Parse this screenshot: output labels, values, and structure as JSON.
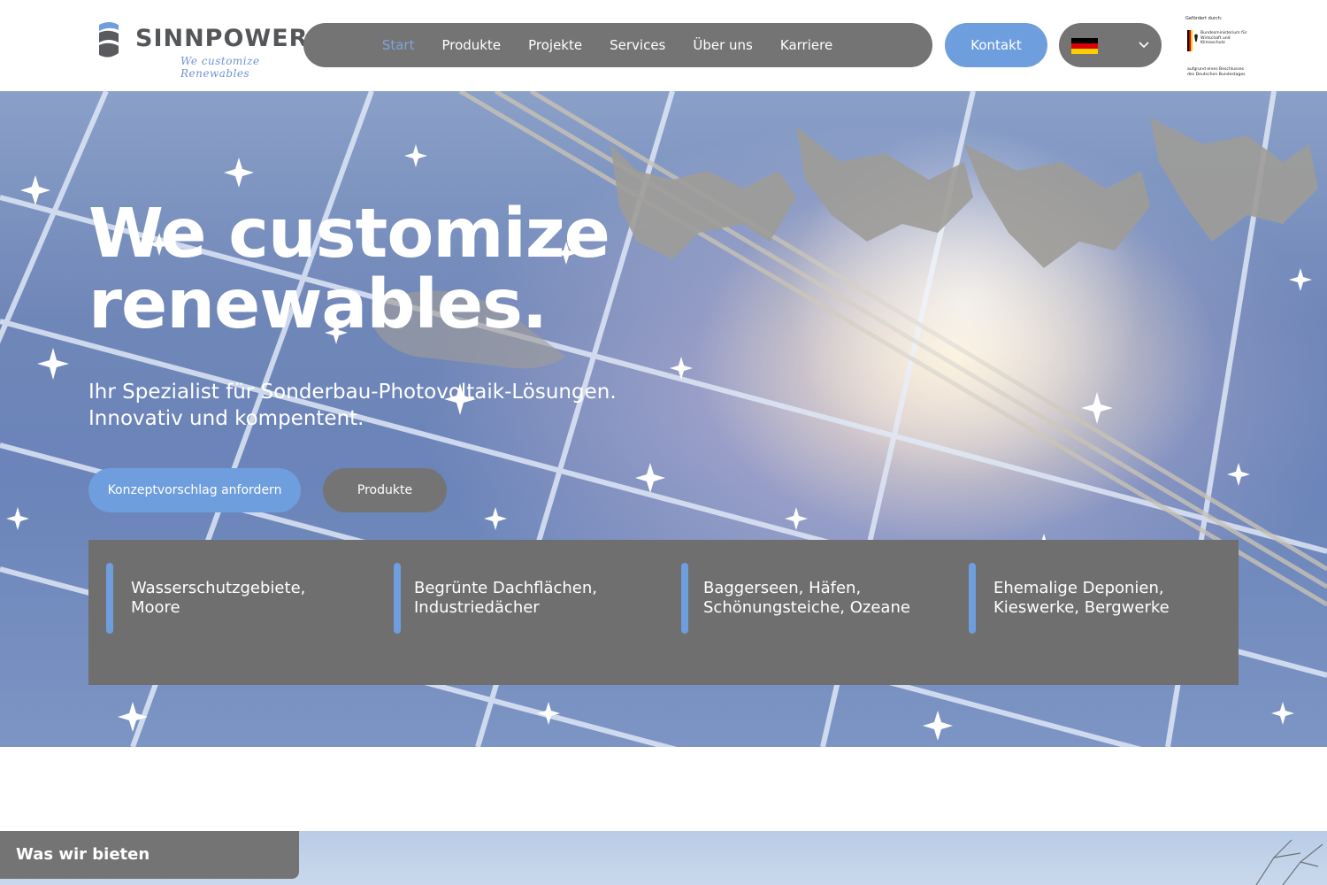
{
  "header": {
    "logo": {
      "wordmark": "SINNPOWER",
      "tagline": "We customize Renewables"
    },
    "nav": [
      {
        "label": "Start",
        "active": true
      },
      {
        "label": "Produkte",
        "active": false
      },
      {
        "label": "Projekte",
        "active": false
      },
      {
        "label": "Services",
        "active": false
      },
      {
        "label": "Über uns",
        "active": false
      },
      {
        "label": "Karriere",
        "active": false
      }
    ],
    "contact_label": "Kontakt",
    "language": {
      "flag": "de-flag-icon"
    },
    "funding": {
      "top": "Gefördert durch:",
      "ministry": "Bundesministerium für Wirtschaft und Klimaschutz",
      "bottom": "aufgrund eines Beschlusses des Deutschen Bundestages"
    }
  },
  "hero": {
    "title_line1": "We customize",
    "title_line2": "renewables.",
    "subtitle_line1": "Ihr Spezialist für Sonderbau-Photovoltaik-Lösungen.",
    "subtitle_line2": "Innovativ und kompentent.",
    "primary_button": "Konzeptvorschlag anfordern",
    "secondary_button": "Produkte",
    "features": [
      {
        "line1": "Wasserschutzgebiete,",
        "line2": "Moore"
      },
      {
        "line1": "Begrünte Dachflächen,",
        "line2": "Industriedächer"
      },
      {
        "line1": "Baggerseen, Häfen,",
        "line2": "Schönungsteiche, Ozeane"
      },
      {
        "line1": "Ehemalige Deponien,",
        "line2": "Kieswerke, Bergwerke"
      }
    ]
  },
  "section_tag": "Was wir bieten",
  "colors": {
    "accent": "#6f9ede",
    "nav_bg": "#747474",
    "active_nav": "#7ea4dc",
    "feature_bg": "#6f6f6f"
  }
}
